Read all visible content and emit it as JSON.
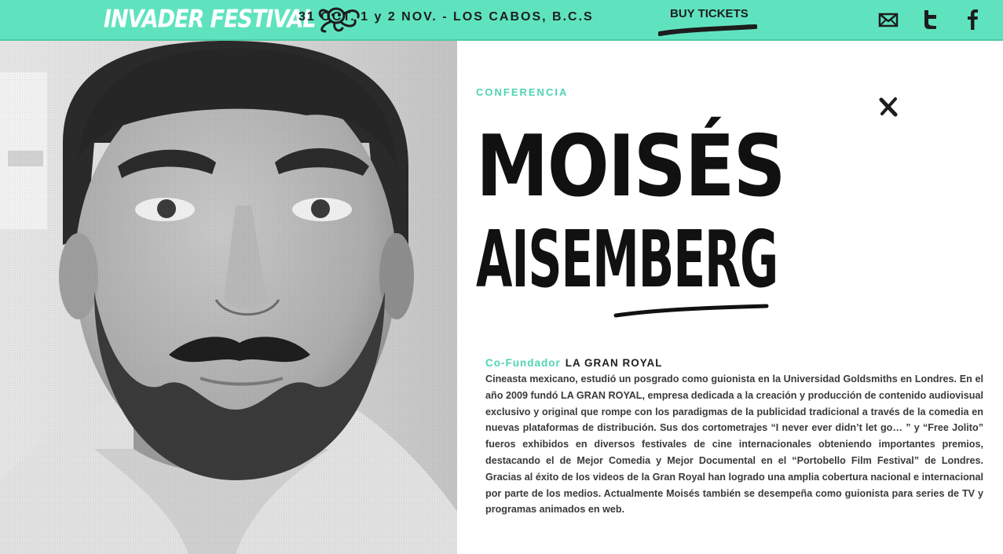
{
  "header": {
    "logo_text": "INVADER FESTIVAL",
    "dates": "31 OCT. 1 y 2 NOV. - LOS CABOS, B.C.S",
    "buy_tickets": "BUY TICKETS",
    "social_icons": [
      "mail-icon",
      "twitter-icon",
      "facebook-icon"
    ],
    "accent_color": "#5fe3bf"
  },
  "photo": {
    "description_icon": "speaker-portrait-photo"
  },
  "panel": {
    "section": "CONFERENCIA",
    "name_line1": "MOISÉS",
    "name_line2": "AISEMBERG",
    "role_title": "Co-Fundador",
    "role_company": "LA GRAN ROYAL",
    "bio": "Cineasta mexicano, estudió un posgrado como guionista en la Universidad Goldsmiths en Londres. En el año 2009 fundó LA GRAN ROYAL, empresa dedicada a la creación y producción de contenido audiovisual exclusivo y original que rompe con los paradigmas de la publicidad tradicional a través de la comedia en nuevas plataformas de distribución. Sus dos cortometrajes “I never ever didn’t let go… ” y “Free Jolito” fueros exhibidos en diversos festivales de cine internacionales obteniendo importantes premios, destacando el de Mejor Comedia y Mejor Documental en el “Portobello Film Festival” de Londres. Gracias al éxito de los videos de la Gran Royal han logrado una amplia cobertura nacional e internacional por parte de los medios. Actualmente Moisés también se desempeña como guionista para series de TV y programas animados en web.",
    "accent_color": "#4fd4b2",
    "close_icon": "close-icon"
  }
}
